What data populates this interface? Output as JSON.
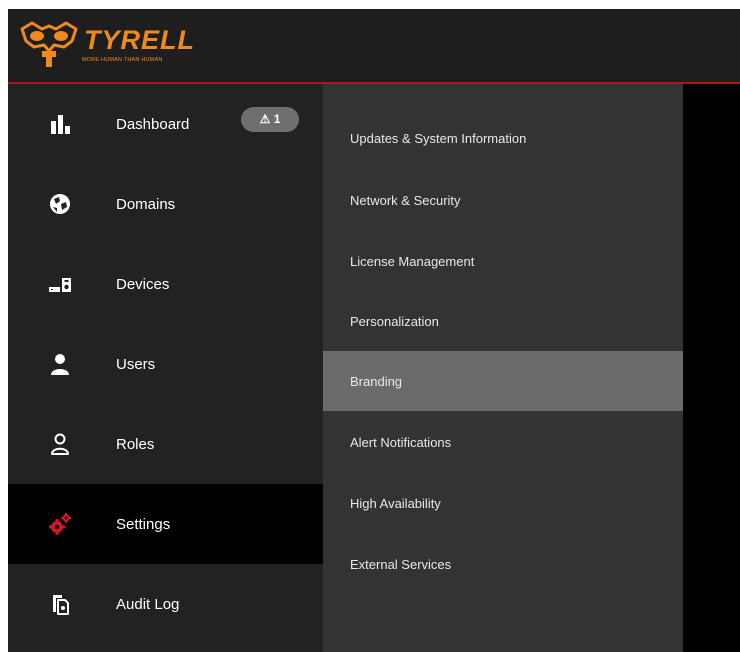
{
  "brand": {
    "name": "TYRELL",
    "tagline": "MORE HUMAN THAN HUMAN",
    "accent": "#f08a1c",
    "rule_color": "#b0151c"
  },
  "nav": {
    "items": [
      {
        "label": "Dashboard",
        "icon": "bar-chart-icon",
        "badge": "⚠ 1"
      },
      {
        "label": "Domains",
        "icon": "globe-icon"
      },
      {
        "label": "Devices",
        "icon": "devices-icon"
      },
      {
        "label": "Users",
        "icon": "user-icon"
      },
      {
        "label": "Roles",
        "icon": "role-outline-icon"
      },
      {
        "label": "Settings",
        "icon": "gears-icon",
        "active": true,
        "icon_color": "#d0182b"
      },
      {
        "label": "Audit Log",
        "icon": "audit-log-icon"
      }
    ]
  },
  "settings_menu": {
    "items": [
      {
        "label": "Updates & System Information"
      },
      {
        "label": "Network & Security"
      },
      {
        "label": "License Management"
      },
      {
        "label": "Personalization"
      },
      {
        "label": "Branding",
        "active": true
      },
      {
        "label": "Alert Notifications"
      },
      {
        "label": "High Availability"
      },
      {
        "label": "External Services"
      }
    ]
  }
}
